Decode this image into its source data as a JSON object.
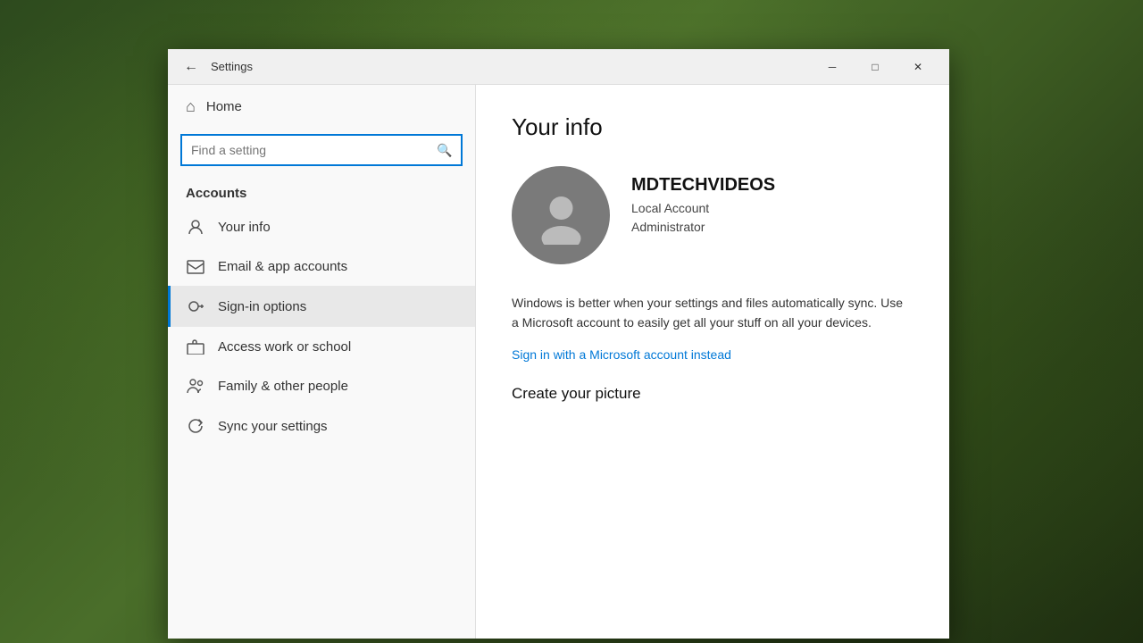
{
  "background": {
    "description": "Forest/moss desktop background"
  },
  "window": {
    "title": "Settings",
    "titlebar": {
      "back_label": "←",
      "title": "Settings",
      "minimize_label": "─",
      "maximize_label": "□",
      "close_label": "✕"
    }
  },
  "sidebar": {
    "home_label": "Home",
    "search_placeholder": "Find a setting",
    "search_icon_label": "🔍",
    "section_heading": "Accounts",
    "nav_items": [
      {
        "id": "your-info",
        "label": "Your info",
        "icon": "person"
      },
      {
        "id": "email-accounts",
        "label": "Email & app accounts",
        "icon": "email"
      },
      {
        "id": "sign-in-options",
        "label": "Sign-in options",
        "icon": "key",
        "active": true
      },
      {
        "id": "access-work",
        "label": "Access work or school",
        "icon": "briefcase"
      },
      {
        "id": "family-people",
        "label": "Family & other people",
        "icon": "family"
      },
      {
        "id": "sync-settings",
        "label": "Sync your settings",
        "icon": "sync"
      }
    ]
  },
  "main": {
    "page_title": "Your info",
    "avatar_alt": "User avatar placeholder",
    "username": "MDTECHVIDEOS",
    "account_type_line1": "Local Account",
    "account_type_line2": "Administrator",
    "description": "Windows is better when your settings and files automatically sync. Use a Microsoft account to easily get all your stuff on all your devices.",
    "ms_account_link": "Sign in with a Microsoft account instead",
    "create_picture_heading": "Create your picture"
  }
}
